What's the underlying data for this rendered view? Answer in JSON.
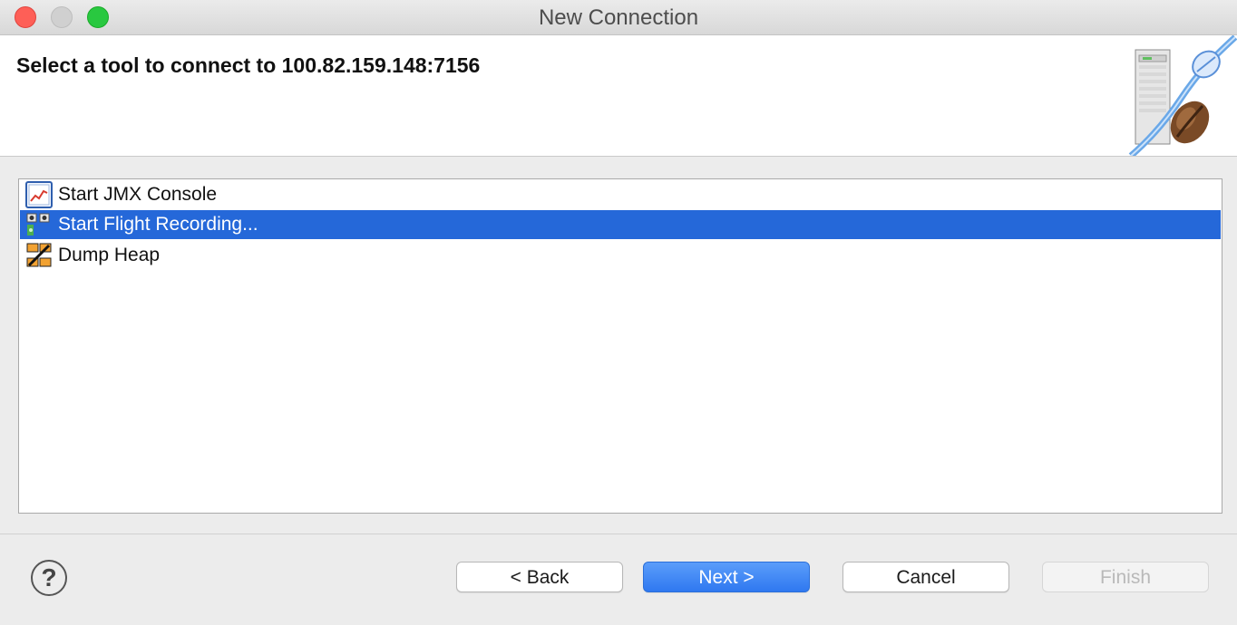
{
  "window": {
    "title": "New Connection"
  },
  "banner": {
    "title": "Select a tool to connect to 100.82.159.148:7156"
  },
  "tools": [
    {
      "label": "Start JMX Console",
      "icon": "jmx-console-icon",
      "selected": false
    },
    {
      "label": "Start Flight Recording...",
      "icon": "flight-recording-icon",
      "selected": true
    },
    {
      "label": "Dump Heap",
      "icon": "dump-heap-icon",
      "selected": false
    }
  ],
  "buttons": {
    "help": "?",
    "back": "< Back",
    "next": "Next >",
    "cancel": "Cancel",
    "finish": "Finish"
  },
  "colors": {
    "selection": "#2568d9",
    "primary_button": "#3b83f3"
  }
}
